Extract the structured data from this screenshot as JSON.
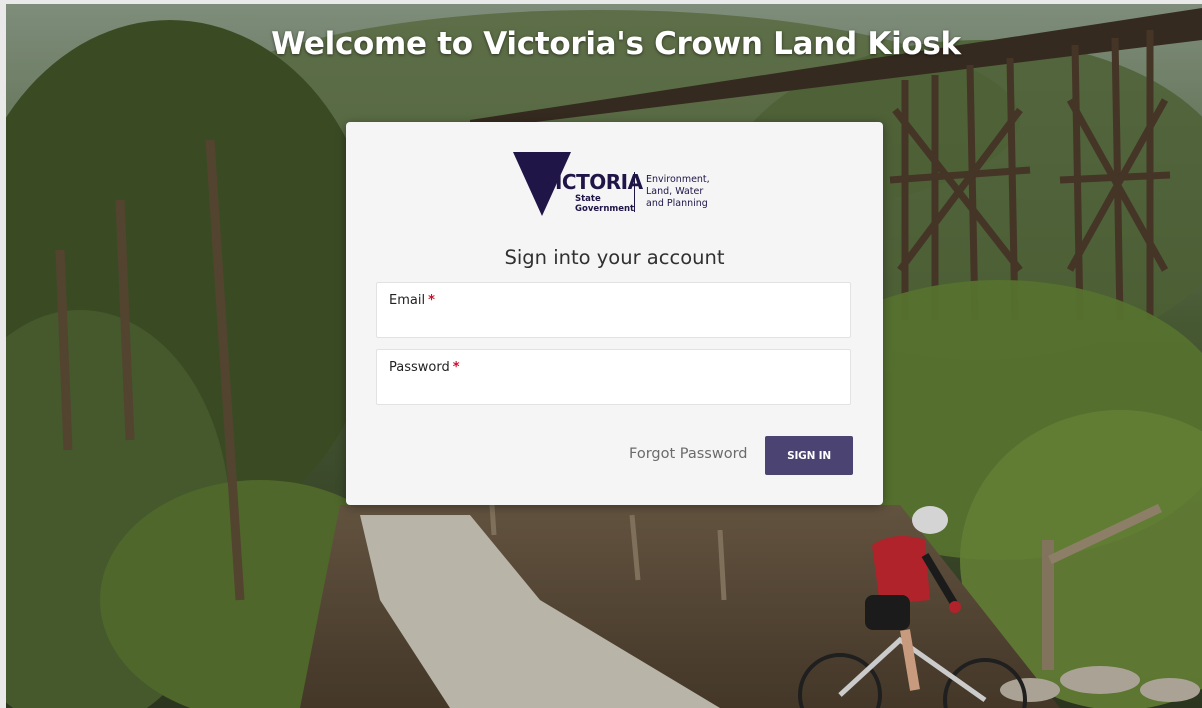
{
  "page": {
    "welcome_title": "Welcome to Victoria's Crown Land Kiosk"
  },
  "logo": {
    "name": "victoria-state-government-logo",
    "wordmark": "VICTORIA",
    "state_line1": "State",
    "state_line2": "Government",
    "dept_line1": "Environment,",
    "dept_line2": "Land, Water",
    "dept_line3": "and Planning"
  },
  "form": {
    "heading": "Sign into your account",
    "email": {
      "label": "Email",
      "required_mark": "*",
      "value": "",
      "placeholder": ""
    },
    "password": {
      "label": "Password",
      "required_mark": "*",
      "value": "",
      "placeholder": ""
    },
    "forgot_password_label": "Forgot Password",
    "signin_label": "SIGN IN"
  },
  "colors": {
    "brand_navy": "#201547",
    "button_purple": "#4b4371",
    "required_red": "#c8102e",
    "card_bg": "#f5f5f6"
  }
}
